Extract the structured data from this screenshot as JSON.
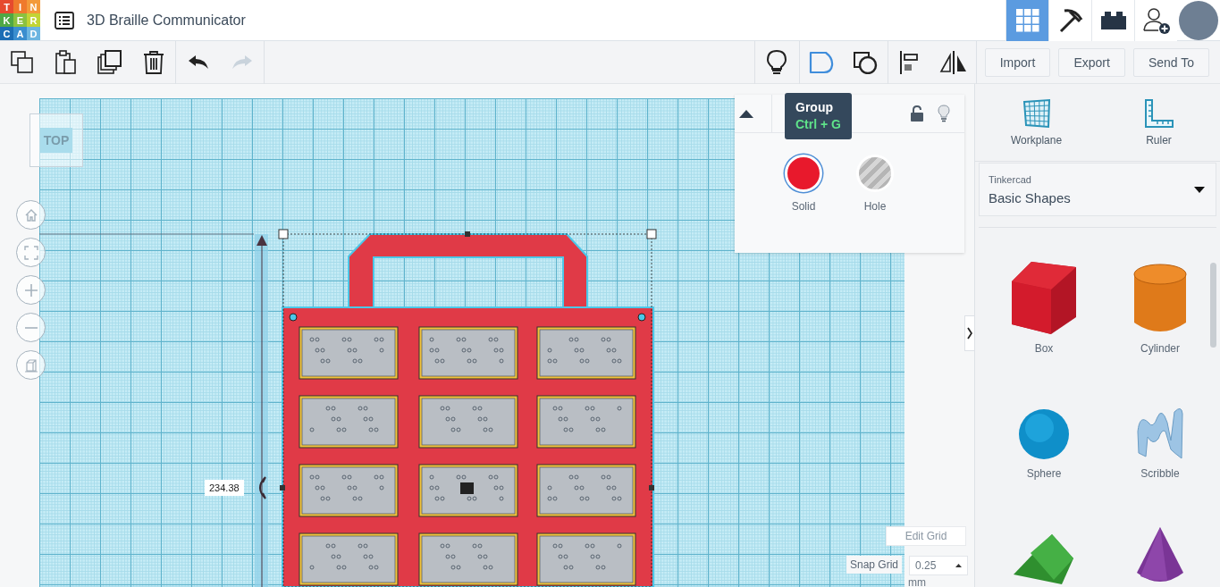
{
  "app": {
    "logo": [
      "T",
      "I",
      "N",
      "K",
      "E",
      "R",
      "C",
      "A",
      "D"
    ],
    "title": "3D Braille Communicator"
  },
  "header_buttons": [
    {
      "kind": "grid",
      "selected": true
    },
    {
      "kind": "pickaxe",
      "selected": false
    },
    {
      "kind": "brick",
      "selected": false
    },
    {
      "kind": "add_user",
      "selected": false
    }
  ],
  "edit_tools": [
    {
      "kind": "copy",
      "disabled": false
    },
    {
      "kind": "paste",
      "disabled": false
    },
    {
      "kind": "duplicate",
      "disabled": false
    },
    {
      "kind": "delete",
      "disabled": false
    },
    {
      "kind": "undo",
      "disabled": false
    },
    {
      "kind": "redo",
      "disabled": true
    }
  ],
  "view_tools": [
    {
      "kind": "light",
      "hovered": false
    },
    {
      "kind": "group",
      "hovered": true
    },
    {
      "kind": "ungroup",
      "hovered": false
    },
    {
      "kind": "align",
      "hovered": false
    },
    {
      "kind": "mirror",
      "hovered": false
    }
  ],
  "file_buttons": [
    "Import",
    "Export",
    "Send To"
  ],
  "tooltip": {
    "title": "Group",
    "shortcut": "Ctrl + G"
  },
  "inspector": {
    "options": [
      {
        "label": "Solid",
        "selected": true
      },
      {
        "label": "Hole",
        "selected": false
      }
    ]
  },
  "canvas": {
    "view_cube": "TOP",
    "dimension": "234.38",
    "edit_grid": "Edit Grid",
    "snap_label": "Snap Grid",
    "snap_value": "0.25",
    "snap_unit": "mm"
  },
  "library": {
    "tools": [
      {
        "kind": "workplane",
        "label": "Workplane"
      },
      {
        "kind": "ruler",
        "label": "Ruler"
      }
    ],
    "source": "Tinkercad",
    "category": "Basic Shapes",
    "shapes": [
      {
        "kind": "box",
        "label": "Box"
      },
      {
        "kind": "cylinder",
        "label": "Cylinder"
      },
      {
        "kind": "sphere",
        "label": "Sphere"
      },
      {
        "kind": "scribble",
        "label": "Scribble"
      },
      {
        "kind": "wedge"
      },
      {
        "kind": "cone"
      }
    ]
  }
}
